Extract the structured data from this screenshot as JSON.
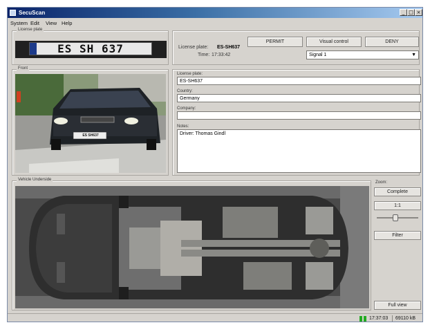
{
  "window": {
    "title": "SecuScan"
  },
  "menu": [
    "System",
    "Edit",
    "View",
    "Help"
  ],
  "groups": {
    "license_plate": "License plate",
    "front": "Front",
    "vehicle_underside": "Vehicle Underside",
    "zoom": "Zoom:"
  },
  "plate_image_text": "ES SH 637",
  "plate_photo_text": "ES SH637",
  "info": {
    "plate_label": "License plate:",
    "plate_value": "ES-SH637",
    "time_label": "Time:",
    "time_value": "17:33:42"
  },
  "actions": {
    "permit": "PERMIT",
    "visual_control": "Visual control",
    "deny": "DENY"
  },
  "signal": {
    "selected": "Signal 1"
  },
  "form": {
    "license_plate": {
      "label": "License plate:",
      "value": "ES-SH637"
    },
    "country": {
      "label": "Country:",
      "value": "Germany"
    },
    "company": {
      "label": "Company:",
      "value": ""
    },
    "notes": {
      "label": "Notes:",
      "value": "Driver: Thomas Gindl"
    }
  },
  "zoom": {
    "complete": "Complete",
    "one_to_one": "1:1",
    "filter": "Filter",
    "full_view": "Full view",
    "slider_level": 0.45
  },
  "status": {
    "time": "17:37:03",
    "memory": "69110 kB"
  },
  "colors": {
    "title_start": "#0a246a",
    "title_end": "#a6caf0",
    "window_bg": "#d6d3ce",
    "status_ok": "#22aa22"
  }
}
